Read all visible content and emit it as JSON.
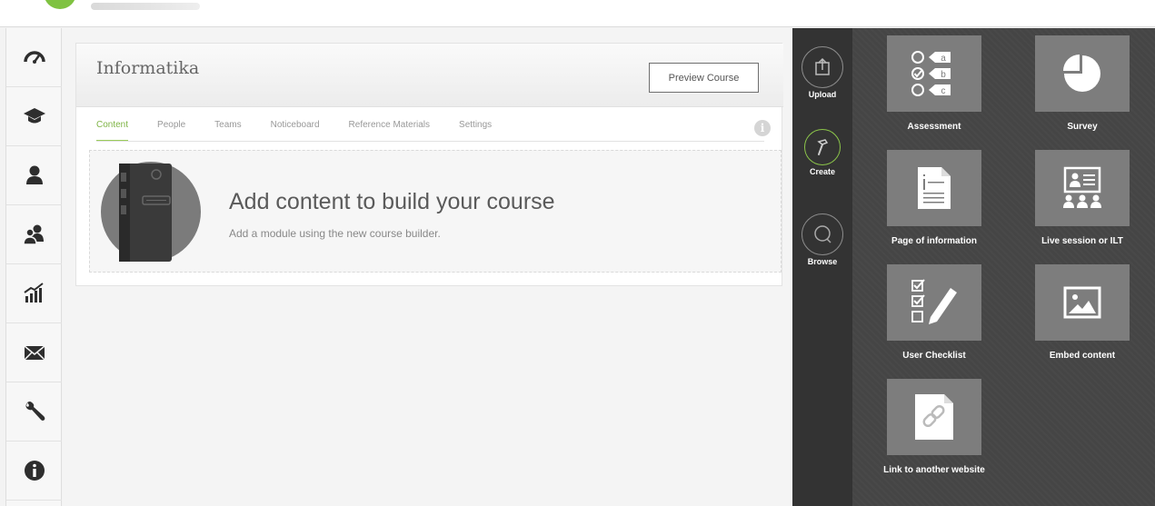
{
  "course": {
    "title": "Informatika",
    "preview_label": "Preview Course",
    "tabs": [
      {
        "label": "Content",
        "active": true
      },
      {
        "label": "People",
        "active": false
      },
      {
        "label": "Teams",
        "active": false
      },
      {
        "label": "Noticeboard",
        "active": false
      },
      {
        "label": "Reference Materials",
        "active": false
      },
      {
        "label": "Settings",
        "active": false
      }
    ],
    "info_glyph": "i",
    "empty_title": "Add content to build your course",
    "empty_subtitle": "Add a module using the new course builder."
  },
  "left_nav": [
    {
      "icon": "dashboard-gauge-icon"
    },
    {
      "icon": "graduation-cap-icon"
    },
    {
      "icon": "user-icon"
    },
    {
      "icon": "users-icon"
    },
    {
      "icon": "reports-chart-icon"
    },
    {
      "icon": "mail-envelope-icon"
    },
    {
      "icon": "wrench-icon"
    },
    {
      "icon": "info-icon"
    }
  ],
  "rail": {
    "upload": "Upload",
    "create": "Create",
    "browse": "Browse"
  },
  "tiles": {
    "assessment": "Assessment",
    "survey": "Survey",
    "page_info": "Page of information",
    "live_session": "Live session or ILT",
    "user_checklist": "User Checklist",
    "embed_content": "Embed content",
    "link_website": "Link to another website",
    "assessment_options": [
      "a",
      "b",
      "c"
    ]
  },
  "colors": {
    "accent_green": "#8cc54a",
    "rail_bg": "#333333",
    "panel_bg": "#454545",
    "tile_bg": "#7d7d7d"
  }
}
